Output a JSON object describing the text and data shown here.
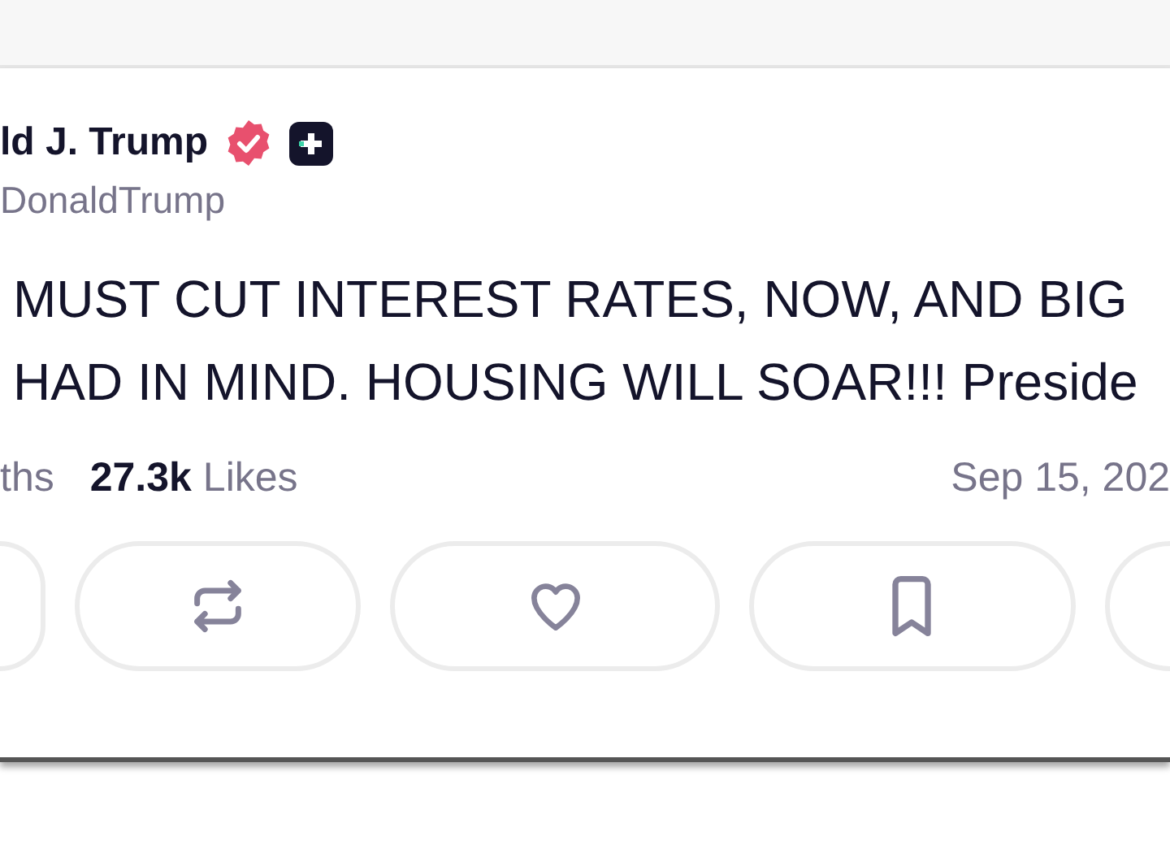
{
  "post": {
    "author": {
      "name": "ld J. Trump",
      "handle": "DonaldTrump"
    },
    "lines": [
      "MUST CUT INTEREST RATES, NOW, AND BIG",
      "HAD IN MIND. HOUSING WILL SOAR!!! Preside"
    ],
    "stats": [
      {
        "label": "ths"
      },
      {
        "count": "27.3k",
        "label": "Likes"
      }
    ],
    "date": "Sep 15, 202",
    "actions": [
      {
        "kind": "edge-left"
      },
      {
        "kind": "repost"
      },
      {
        "kind": "like"
      },
      {
        "kind": "bookmark"
      },
      {
        "kind": "edge-right"
      }
    ]
  }
}
